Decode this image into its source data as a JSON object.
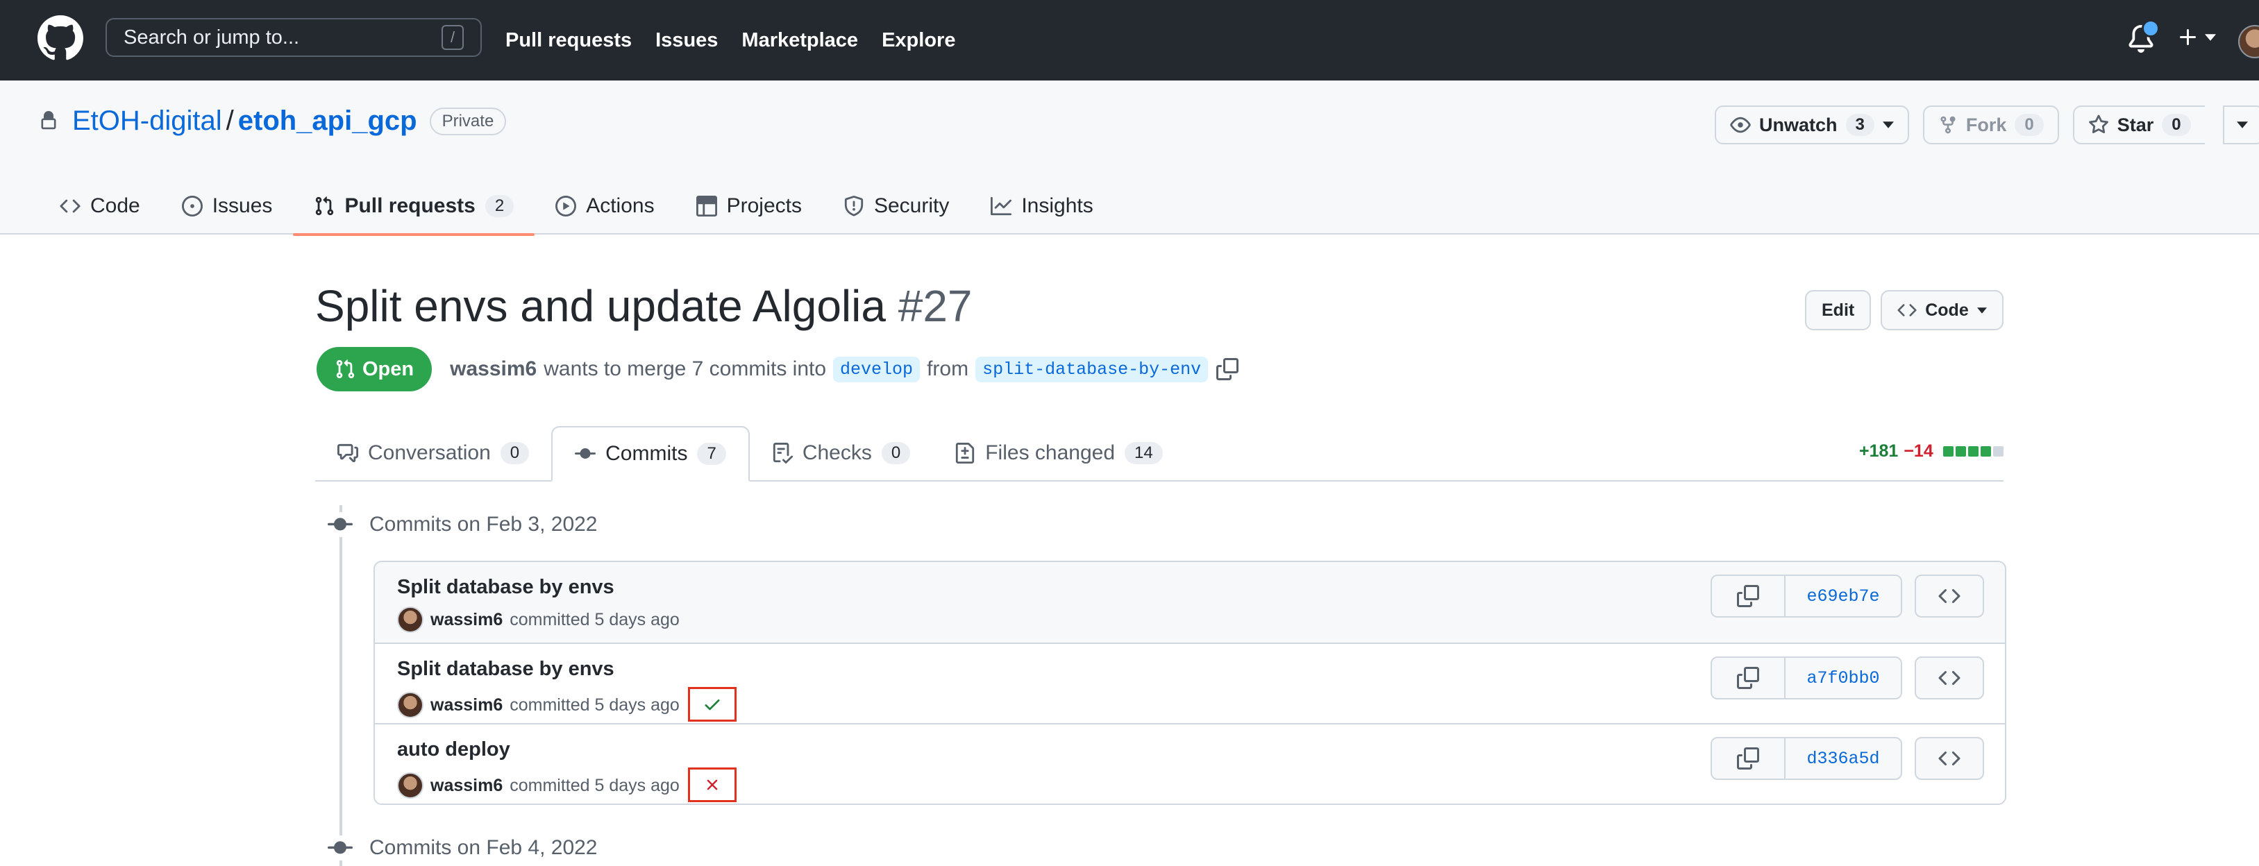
{
  "header": {
    "search_placeholder": "Search or jump to...",
    "search_shortcut": "/",
    "nav": [
      "Pull requests",
      "Issues",
      "Marketplace",
      "Explore"
    ]
  },
  "repo": {
    "owner": "EtOH-digital",
    "separator": "/",
    "name": "etoh_api_gcp",
    "visibility": "Private",
    "watch": {
      "label": "Unwatch",
      "count": "3"
    },
    "fork": {
      "label": "Fork",
      "count": "0"
    },
    "star": {
      "label": "Star",
      "count": "0"
    },
    "tabs": [
      {
        "label": "Code",
        "icon": "code-icon"
      },
      {
        "label": "Issues",
        "icon": "issue-opened-icon"
      },
      {
        "label": "Pull requests",
        "icon": "git-pull-request-icon",
        "count": "2"
      },
      {
        "label": "Actions",
        "icon": "play-icon"
      },
      {
        "label": "Projects",
        "icon": "table-icon"
      },
      {
        "label": "Security",
        "icon": "shield-icon"
      },
      {
        "label": "Insights",
        "icon": "graph-icon"
      }
    ],
    "selected_tab": "Pull requests"
  },
  "pr": {
    "title": "Split envs and update Algolia",
    "number": "#27",
    "edit_label": "Edit",
    "code_label": "Code",
    "state": "Open",
    "author": "wassim6",
    "merge_text_1": "wants to merge 7 commits into",
    "base_branch": "develop",
    "merge_text_2": "from",
    "head_branch": "split-database-by-env",
    "tabs": [
      {
        "label": "Conversation",
        "count": "0",
        "icon": "comment-discussion-icon"
      },
      {
        "label": "Commits",
        "count": "7",
        "icon": "git-commit-icon"
      },
      {
        "label": "Checks",
        "count": "0",
        "icon": "checklist-icon"
      },
      {
        "label": "Files changed",
        "count": "14",
        "icon": "file-diff-icon"
      }
    ],
    "selected_tab": "Commits",
    "diffstat": {
      "additions": "+181",
      "deletions": "−14",
      "blocks_filled": 4,
      "blocks_total": 5
    }
  },
  "timeline": {
    "groups": [
      {
        "heading": "Commits on Feb 3, 2022",
        "commits": [
          {
            "message": "Split database by envs",
            "author": "wassim6",
            "meta": "committed 5 days ago",
            "sha": "e69eb7e",
            "status": "none"
          },
          {
            "message": "Split database by envs",
            "author": "wassim6",
            "meta": "committed 5 days ago",
            "sha": "a7f0bb0",
            "status": "success"
          },
          {
            "message": "auto deploy",
            "author": "wassim6",
            "meta": "committed 5 days ago",
            "sha": "d336a5d",
            "status": "failure"
          }
        ]
      },
      {
        "heading": "Commits on Feb 4, 2022",
        "commits": []
      }
    ]
  },
  "colors": {
    "header_bg": "#24292f",
    "link": "#0969da",
    "open_green": "#2da44e",
    "selected_tab_underline": "#fd8c73",
    "success": "#1a7f37",
    "failure": "#cf222e",
    "highlight_box": "#e0321f"
  }
}
